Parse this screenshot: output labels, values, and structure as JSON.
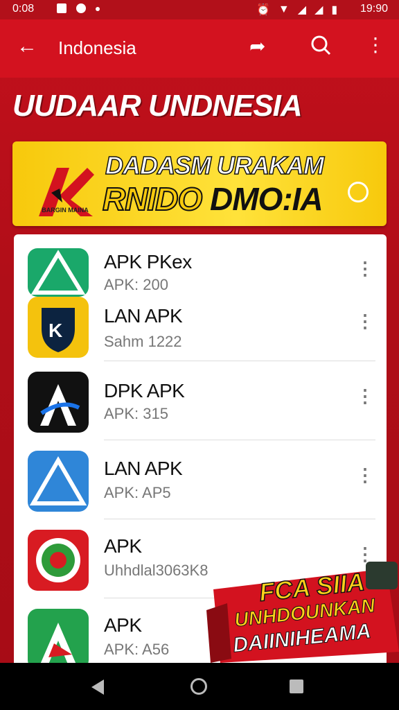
{
  "status_bar": {
    "time": "0:08",
    "clock": "19:90"
  },
  "app_bar": {
    "title": "Indonesia"
  },
  "page_heading": "UUDAAR UNDNESIA",
  "promo": {
    "line1": "DADASM URAKAM",
    "line2_a": "RNIDO",
    "line2_b": "DMO:IA",
    "logo_text": "BARGIN MAINA"
  },
  "apps": [
    {
      "name": "APK PKex",
      "sub": "APK: 200",
      "icon": "triangle-logo-icon",
      "color": "#1aa86a"
    },
    {
      "name": "LAN APK",
      "sub": "Sahm 1222",
      "icon": "k-shield-icon",
      "color": "#f4c20d"
    },
    {
      "name": "DPK APK",
      "sub": "APK: 315",
      "icon": "a-letter-icon",
      "color": "#111111"
    },
    {
      "name": "LAN APK",
      "sub": "APK: AP5",
      "icon": "triangle-logo-icon",
      "color": "#2f86d8"
    },
    {
      "name": "APK",
      "sub": "Uhhdlal3063K8",
      "icon": "emblem-icon",
      "color": "#d81b22"
    },
    {
      "name": "APK",
      "sub": "APK: A56",
      "icon": "a-letter-icon",
      "color": "#23a24d"
    }
  ],
  "corner_badge": {
    "line1": "FCA SIIA",
    "line2": "UNHDOUNKAN",
    "line3": "DAIINIHEAMA"
  },
  "colors": {
    "accent": "#d3121f",
    "banner": "#f7c90c"
  }
}
